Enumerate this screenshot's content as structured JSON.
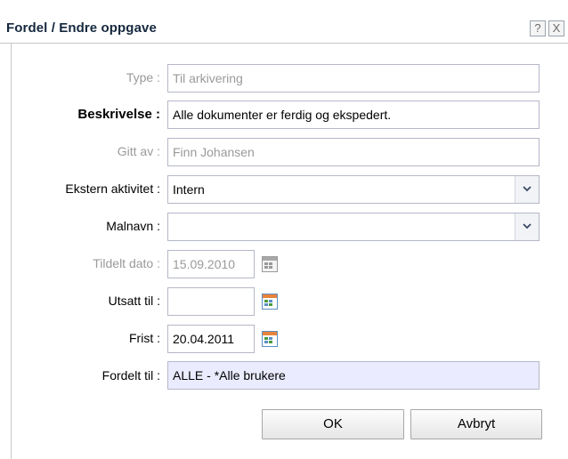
{
  "window": {
    "title": "Fordel / Endre oppgave",
    "help_label": "?",
    "close_label": "X"
  },
  "form": {
    "type": {
      "label": "Type :",
      "value": "Til arkivering"
    },
    "beskrivelse": {
      "label": "Beskrivelse :",
      "value": "Alle dokumenter er ferdig og ekspedert."
    },
    "gitt_av": {
      "label": "Gitt av :",
      "value": "Finn Johansen"
    },
    "ekstern_aktivitet": {
      "label": "Ekstern aktivitet :",
      "value": "Intern"
    },
    "malnavn": {
      "label": "Malnavn :",
      "value": ""
    },
    "tildelt_dato": {
      "label": "Tildelt dato :",
      "value": "15.09.2010"
    },
    "utsatt_til": {
      "label": "Utsatt til :",
      "value": ""
    },
    "frist": {
      "label": "Frist :",
      "value": "20.04.2011"
    },
    "fordelt_til": {
      "label": "Fordelt til :",
      "value": "ALLE - *Alle brukere"
    }
  },
  "buttons": {
    "ok": "OK",
    "cancel": "Avbryt"
  },
  "colors": {
    "title_text": "#15283e",
    "highlight_bg": "#ebebff",
    "border": "#b5b8c8",
    "disabled_text": "#9a9a9a"
  }
}
